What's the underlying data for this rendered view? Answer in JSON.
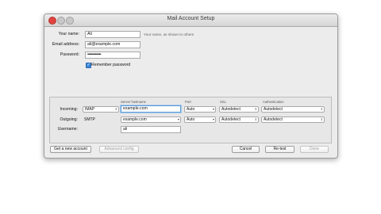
{
  "window": {
    "title": "Mail Account Setup"
  },
  "form": {
    "name_label": "Your name:",
    "name_value": "Ali",
    "name_hint": "Your name, as shown to others",
    "email_label": "Email address:",
    "email_value": "ali@example.com",
    "password_label": "Password:",
    "password_value": "••••••••••••••",
    "remember_label": "Remember password",
    "remember_checked": true
  },
  "server": {
    "headers": {
      "hostname": "Server hostname",
      "port": "Port",
      "ssl": "SSL",
      "auth": "Authentication"
    },
    "incoming": {
      "label": "Incoming:",
      "protocol": "IMAP",
      "hostname": "example.com",
      "port": "Auto",
      "ssl": "Autodetect",
      "auth": "Autodetect"
    },
    "outgoing": {
      "label": "Outgoing:",
      "protocol": "SMTP",
      "hostname": "example.com",
      "port": "Auto",
      "ssl": "Autodetect",
      "auth": "Autodetect"
    },
    "username": {
      "label": "Username:",
      "value": "ali"
    }
  },
  "buttons": {
    "new_account": "Get a new account",
    "advanced": "Advanced config",
    "cancel": "Cancel",
    "retest": "Re-test",
    "done": "Done"
  },
  "icons": {
    "arrows": "▾",
    "updown": "⇕",
    "check": "✓"
  }
}
